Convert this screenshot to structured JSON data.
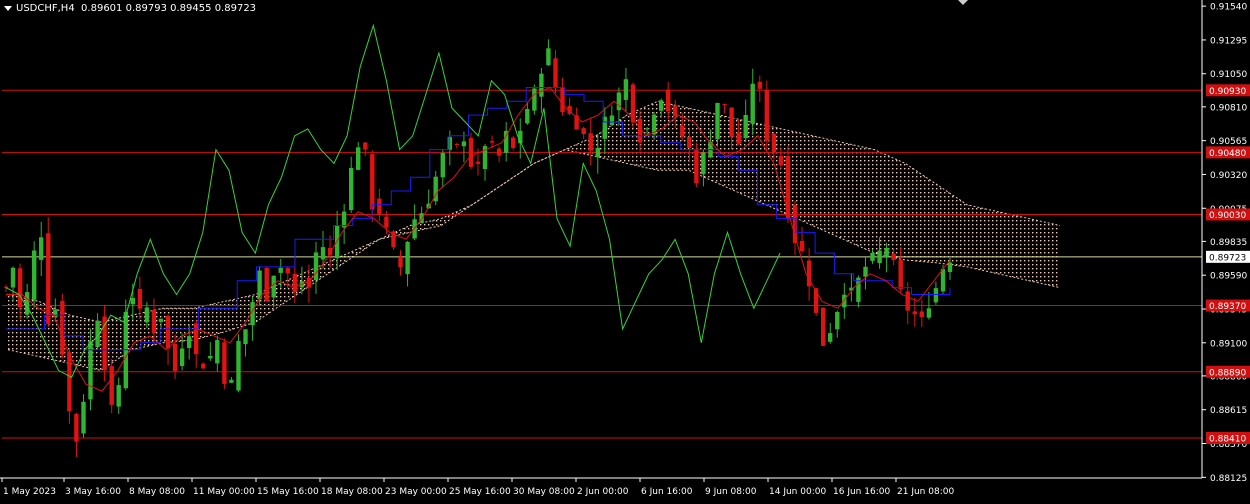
{
  "header": {
    "symbol": "USDCHF,H4",
    "open": "0.89601",
    "high": "0.89793",
    "low": "0.89455",
    "close": "0.89723"
  },
  "colors": {
    "background": "#000000",
    "bull_candle": "#2fb52f",
    "bear_candle": "#e01212",
    "tenkan": "#e01212",
    "kijun": "#1a1aff",
    "chikou": "#33d633",
    "cloud": "#f0c8b0",
    "level_line": "#d01010",
    "price_line": "#d8d8a0"
  },
  "chart_data": {
    "type": "candlestick",
    "title": "USDCHF,H4",
    "ylim": [
      0.8812,
      0.9157
    ],
    "y_ticks": [
      "0.91540",
      "0.91295",
      "0.91050",
      "0.90810",
      "0.90565",
      "0.90320",
      "0.90075",
      "0.89835",
      "0.89590",
      "0.89345",
      "0.89100",
      "0.88860",
      "0.88615",
      "0.88370",
      "0.88125"
    ],
    "x_ticks": [
      "1 May 2023",
      "3 May 16:00",
      "8 May 08:00",
      "11 May 00:00",
      "15 May 16:00",
      "18 May 08:00",
      "23 May 00:00",
      "25 May 16:00",
      "30 May 08:00",
      "2 Jun 00:00",
      "6 Jun 16:00",
      "9 Jun 08:00",
      "14 Jun 00:00",
      "16 Jun 16:00",
      "21 Jun 08:00"
    ],
    "levels": [
      {
        "label": "0.90930",
        "value": 0.9093
      },
      {
        "label": "0.90480",
        "value": 0.9048
      },
      {
        "label": "0.90030",
        "value": 0.9003
      },
      {
        "label": "0.89370",
        "value": 0.8937
      },
      {
        "label": "0.88890",
        "value": 0.8889
      },
      {
        "label": "0.88410",
        "value": 0.8841
      }
    ],
    "current_price": {
      "label": "0.89723",
      "value": 0.89723
    },
    "close_path": [
      0.895,
      0.8965,
      0.8935,
      0.8945,
      0.8975,
      0.899,
      0.8928,
      0.8935,
      0.8905,
      0.886,
      0.884,
      0.887,
      0.891,
      0.893,
      0.8895,
      0.886,
      0.888,
      0.8935,
      0.8945,
      0.893,
      0.8935,
      0.892,
      0.893,
      0.8905,
      0.889,
      0.891,
      0.892,
      0.89,
      0.8895,
      0.89,
      0.8912,
      0.8885,
      0.888,
      0.891,
      0.892,
      0.894,
      0.896,
      0.8945,
      0.8962,
      0.8965,
      0.896,
      0.8945,
      0.8955,
      0.895,
      0.8975,
      0.898,
      0.8972,
      0.8995,
      0.901,
      0.9035,
      0.9055,
      0.9045,
      0.901,
      0.9005,
      0.899,
      0.8975,
      0.8965,
      0.8985,
      0.9,
      0.9005,
      0.9015,
      0.903,
      0.9045,
      0.9055,
      0.905,
      0.906,
      0.904,
      0.9035,
      0.9055,
      0.905,
      0.9045,
      0.906,
      0.905,
      0.9065,
      0.908,
      0.909,
      0.911,
      0.912,
      0.9095,
      0.908,
      0.9075,
      0.907,
      0.906,
      0.905,
      0.9055,
      0.907,
      0.908,
      0.909,
      0.91,
      0.9075,
      0.906,
      0.9065,
      0.908,
      0.909,
      0.908,
      0.907,
      0.906,
      0.905,
      0.903,
      0.9045,
      0.906,
      0.9085,
      0.908,
      0.906,
      0.9055,
      0.907,
      0.91,
      0.909,
      0.906,
      0.905,
      0.904,
      0.9005,
      0.8985,
      0.8975,
      0.8955,
      0.893,
      0.891,
      0.892,
      0.8935,
      0.895,
      0.8945,
      0.8955,
      0.8965,
      0.897,
      0.8975,
      0.898,
      0.8965,
      0.8945,
      0.8935,
      0.893,
      0.8925,
      0.894,
      0.895,
      0.8965,
      0.8972
    ],
    "tenkan_path": [
      0.8945,
      0.8945,
      0.8935,
      0.893,
      0.89,
      0.888,
      0.8875,
      0.889,
      0.891,
      0.8915,
      0.8905,
      0.8915,
      0.892,
      0.8915,
      0.891,
      0.8925,
      0.8945,
      0.8955,
      0.895,
      0.8955,
      0.897,
      0.899,
      0.9005,
      0.9,
      0.899,
      0.8985,
      0.9,
      0.902,
      0.903,
      0.9045,
      0.905,
      0.9055,
      0.9075,
      0.909,
      0.9095,
      0.908,
      0.907,
      0.9075,
      0.9085,
      0.9075,
      0.906,
      0.9065,
      0.9075,
      0.907,
      0.9055,
      0.9045,
      0.905,
      0.906,
      0.904,
      0.9,
      0.896,
      0.894,
      0.8935,
      0.895,
      0.896,
      0.8955,
      0.8945,
      0.894,
      0.8955,
      0.897
    ],
    "kijun_path": [
      0.892,
      0.892,
      0.893,
      0.8915,
      0.8905,
      0.8905,
      0.8905,
      0.891,
      0.892,
      0.892,
      0.8935,
      0.8935,
      0.8955,
      0.8965,
      0.8965,
      0.8985,
      0.8985,
      0.8995,
      0.9,
      0.901,
      0.902,
      0.903,
      0.905,
      0.906,
      0.9075,
      0.908,
      0.9085,
      0.9095,
      0.9095,
      0.909,
      0.9085,
      0.907,
      0.906,
      0.906,
      0.9055,
      0.905,
      0.905,
      0.9045,
      0.9035,
      0.901,
      0.9,
      0.899,
      0.8975,
      0.896,
      0.8955,
      0.8955,
      0.895,
      0.8945,
      0.8945,
      0.895
    ],
    "chikou_path": [
      0.895,
      0.8945,
      0.893,
      0.891,
      0.889,
      0.8885,
      0.8905,
      0.8915,
      0.893,
      0.8925,
      0.896,
      0.8985,
      0.896,
      0.8945,
      0.896,
      0.899,
      0.905,
      0.9035,
      0.899,
      0.8975,
      0.901,
      0.903,
      0.906,
      0.9065,
      0.905,
      0.904,
      0.906,
      0.911,
      0.914,
      0.91,
      0.905,
      0.906,
      0.909,
      0.912,
      0.908,
      0.907,
      0.906,
      0.91,
      0.909,
      0.906,
      0.904,
      0.908,
      0.9,
      0.898,
      0.904,
      0.902,
      0.8985,
      0.892,
      0.894,
      0.896,
      0.897,
      0.8985,
      0.896,
      0.891,
      0.896,
      0.899,
      0.896,
      0.8935,
      0.8955,
      0.8975
    ],
    "cloud_top": [
      0.8945,
      0.894,
      0.893,
      0.8925,
      0.893,
      0.8935,
      0.8935,
      0.894,
      0.8945,
      0.8955,
      0.8965,
      0.8975,
      0.8985,
      0.8995,
      0.9,
      0.901,
      0.9025,
      0.904,
      0.905,
      0.906,
      0.9075,
      0.9085,
      0.908,
      0.9075,
      0.907,
      0.9065,
      0.906,
      0.9055,
      0.905,
      0.904,
      0.9025,
      0.901,
      0.9005,
      0.9,
      0.8995
    ],
    "cloud_bottom": [
      0.8905,
      0.89,
      0.8895,
      0.889,
      0.8905,
      0.891,
      0.8912,
      0.8918,
      0.8925,
      0.894,
      0.8955,
      0.897,
      0.8985,
      0.899,
      0.8995,
      0.901,
      0.9025,
      0.904,
      0.905,
      0.9045,
      0.904,
      0.9035,
      0.9035,
      0.9025,
      0.9015,
      0.9005,
      0.8995,
      0.8985,
      0.8975,
      0.897,
      0.8968,
      0.8965,
      0.896,
      0.8955,
      0.895
    ]
  }
}
